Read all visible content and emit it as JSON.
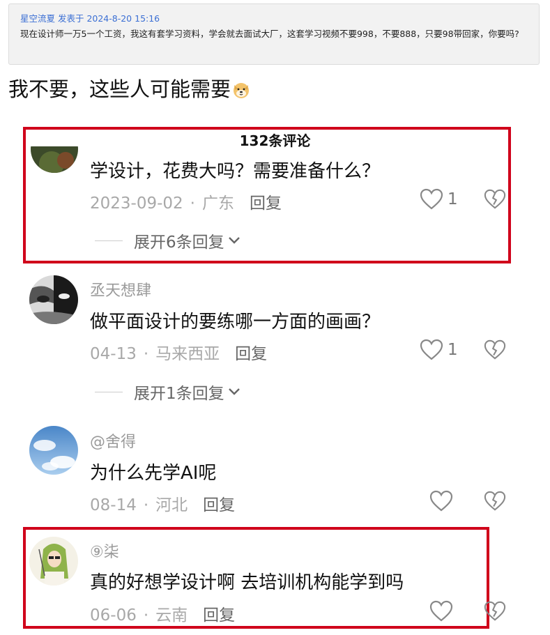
{
  "quote": {
    "meta": "星空流夏 发表于 2024-8-20 15:16",
    "body": "现在设计师一万5一个工资，我这有套学习资料，学会就去面试大厂，这套学习视频不要998，不要888，只要98带回家，你要吗?"
  },
  "reply_text": "我不要，这些人可能需要",
  "comments_header": "132条评论",
  "comments": [
    {
      "content": "学设计，花费大吗？需要准备什么？",
      "date": "2023-09-02",
      "location": "广东",
      "reply_label": "回复",
      "likes": "1",
      "expand_label": "展开6条回复"
    },
    {
      "username": "丞天想肆",
      "content": "做平面设计的要练哪一方面的画画？",
      "date": "04-13",
      "location": "马来西亚",
      "reply_label": "回复",
      "likes": "1",
      "expand_label": "展开1条回复"
    },
    {
      "username": "@舍得",
      "content": "为什么先学AI呢",
      "date": "08-14",
      "location": "河北",
      "reply_label": "回复"
    },
    {
      "username": "⑨柒",
      "content": "真的好想学设计啊 去培训机构能学到吗",
      "date": "06-06",
      "location": "云南",
      "reply_label": "回复"
    }
  ],
  "colors": {
    "highlight": "#d0021b",
    "quote_meta": "#3b6fd4"
  },
  "icons": [
    "heart-icon",
    "broken-heart-icon",
    "chevron-down-icon",
    "dog-emoji-icon"
  ]
}
